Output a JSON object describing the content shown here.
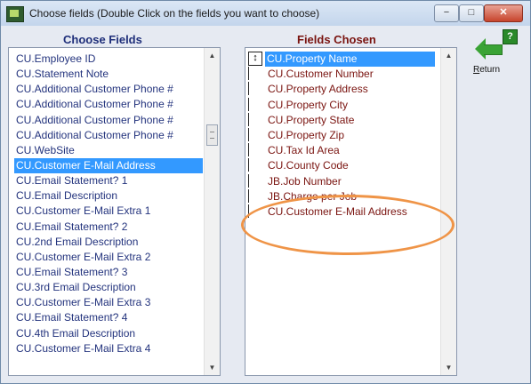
{
  "window": {
    "title": "Choose fields  (Double Click on the fields you want to choose)",
    "buttons": {
      "minimize": "−",
      "maximize": "□",
      "close": "✕"
    }
  },
  "left_list": {
    "heading": "Choose Fields",
    "items": [
      "CU.Employee ID",
      "CU.Statement Note",
      "CU.Additional Customer Phone #",
      "CU.Additional Customer Phone #",
      "CU.Additional Customer Phone #",
      "CU.Additional Customer Phone #",
      "CU.WebSite",
      "CU.Customer E-Mail Address",
      "CU.Email Statement? 1",
      "CU.Email Description",
      "CU.Customer E-Mail  Extra 1",
      "CU.Email Statement? 2",
      "CU.2nd Email Description",
      "CU.Customer E-Mail  Extra 2",
      "CU.Email Statement? 3",
      "CU.3rd Email Description",
      "CU.Customer E-Mail  Extra 3",
      "CU.Email Statement? 4",
      "CU.4th Email Description",
      "CU.Customer E-Mail  Extra 4"
    ],
    "selected_index": 7
  },
  "right_list": {
    "heading": "Fields Chosen",
    "items": [
      "CU.Property Name",
      "CU.Customer Number",
      "CU.Property Address",
      "CU.Property City",
      "CU.Property State",
      "CU.Property Zip",
      "CU.Tax Id Area",
      "CU.County Code",
      "JB.Job Number",
      "JB.Charge per Job",
      "CU.Customer E-Mail Address"
    ],
    "selected_index": 0
  },
  "return_button": {
    "label_underlined": "R",
    "label_rest": "eturn"
  },
  "help_button": {
    "label": "?"
  },
  "colors": {
    "highlight": "#ef9447",
    "selection": "#3399ff",
    "left_text": "#23337d",
    "right_text": "#7a1410"
  },
  "icons": {
    "app": "app-icon",
    "return": "return-arrow-icon",
    "help": "help-icon",
    "sort": "up-down-arrow-icon"
  }
}
